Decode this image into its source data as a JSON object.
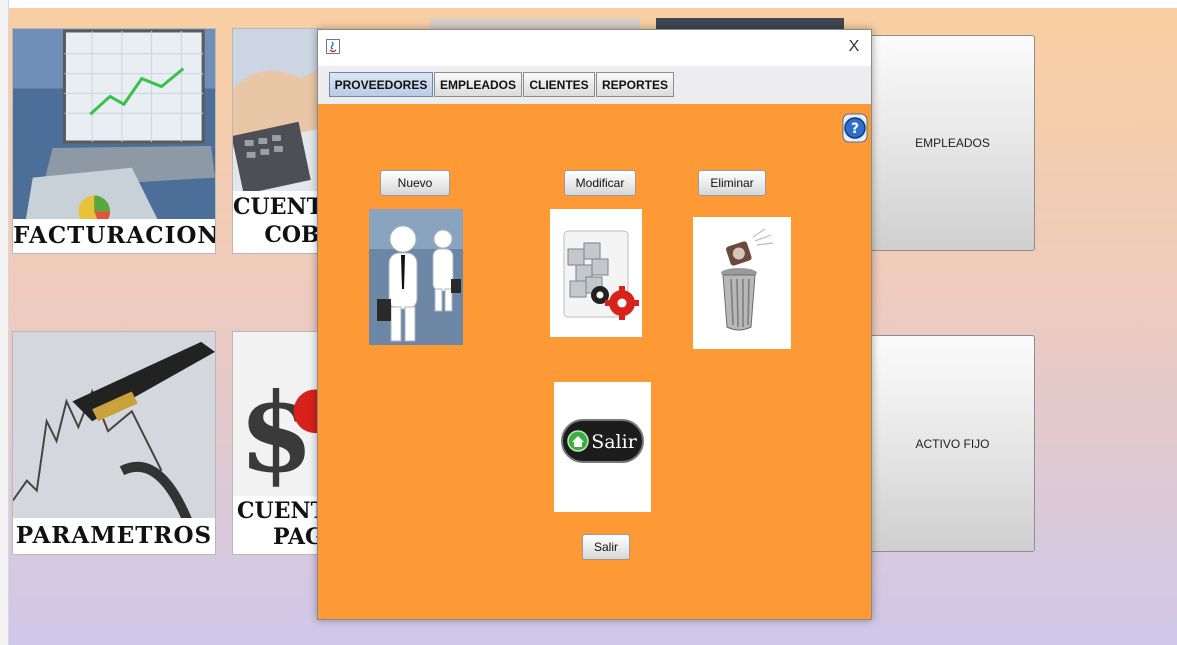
{
  "background_tiles": {
    "facturacion": {
      "caption": "FACTURACION"
    },
    "cuentas_cobrar": {
      "caption_line1": "CUENT",
      "caption_line2": "COB"
    },
    "parametros": {
      "caption": "PARAMETROS"
    },
    "cuentas_pagar": {
      "caption_line1": "CUENTA",
      "caption_line2": "PAG"
    }
  },
  "menu_buttons": {
    "empleados": "EMPLEADOS",
    "activo_fijo": "ACTIVO FIJO"
  },
  "dialog": {
    "tabs": [
      "PROVEEDORES",
      "EMPLEADOS",
      "CLIENTES",
      "REPORTES"
    ],
    "close_label": "X",
    "help_label": "?",
    "buttons": {
      "nuevo": "Nuevo",
      "modificar": "Modificar",
      "eliminar": "Eliminar",
      "salir": "Salir"
    },
    "salir_image_text": "Salir"
  },
  "colors": {
    "panel": "#fd9a36",
    "tab_active": "#b9cce4",
    "background_top": "#f9cfa1",
    "background_bottom": "#cfc8ea"
  },
  "icons": [
    "app-icon",
    "close-icon",
    "help-icon",
    "trash-icon",
    "gear-icon",
    "home-icon"
  ]
}
